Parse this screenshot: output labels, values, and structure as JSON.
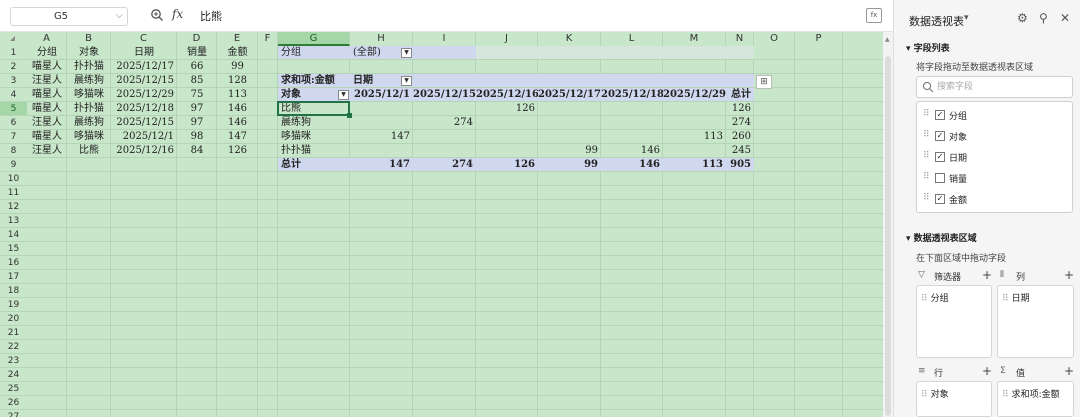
{
  "formula_bar": {
    "name_box": "G5",
    "fx_label": "fx",
    "content": "比熊"
  },
  "columns": [
    "A",
    "B",
    "C",
    "D",
    "E",
    "F",
    "G",
    "H",
    "I",
    "J",
    "K",
    "L",
    "M",
    "N",
    "O",
    "P"
  ],
  "selected_column": "G",
  "rows": [
    "1",
    "2",
    "3",
    "4",
    "5",
    "6",
    "7",
    "8",
    "9",
    "10",
    "11",
    "12",
    "13",
    "14",
    "15",
    "16",
    "17",
    "18",
    "19",
    "20",
    "21",
    "22",
    "23",
    "24",
    "25",
    "26",
    "27"
  ],
  "selected_row": "5",
  "source_table": {
    "headers": [
      "分组",
      "对象",
      "日期",
      "销量",
      "金额"
    ],
    "rows": [
      [
        "喵星人",
        "扑扑猫",
        "2025/12/17",
        "66",
        "99"
      ],
      [
        "汪星人",
        "晨练狗",
        "2025/12/15",
        "85",
        "128"
      ],
      [
        "喵星人",
        "哆猫咪",
        "2025/12/29",
        "75",
        "113"
      ],
      [
        "喵星人",
        "扑扑猫",
        "2025/12/18",
        "97",
        "146"
      ],
      [
        "汪星人",
        "晨练狗",
        "2025/12/15",
        "97",
        "146"
      ],
      [
        "喵星人",
        "哆猫咪",
        "2025/12/1",
        "98",
        "147"
      ],
      [
        "汪星人",
        "比熊",
        "2025/12/16",
        "84",
        "126"
      ]
    ]
  },
  "pivot": {
    "filter_label": "分组",
    "filter_value": "(全部)",
    "value_label": "求和项:金额",
    "col_field": "日期",
    "row_field": "对象",
    "col_headers": [
      "2025/12/1",
      "2025/12/15",
      "2025/12/16",
      "2025/12/17",
      "2025/12/18",
      "2025/12/29",
      "总计"
    ],
    "rows": [
      {
        "label": "比熊",
        "values": [
          "",
          "",
          "126",
          "",
          "",
          "",
          "126"
        ]
      },
      {
        "label": "晨练狗",
        "values": [
          "",
          "274",
          "",
          "",
          "",
          "",
          "274"
        ]
      },
      {
        "label": "哆猫咪",
        "values": [
          "147",
          "",
          "",
          "",
          "",
          "113",
          "260"
        ]
      },
      {
        "label": "扑扑猫",
        "values": [
          "",
          "",
          "",
          "99",
          "146",
          "",
          "245"
        ]
      }
    ],
    "total": {
      "label": "总计",
      "values": [
        "147",
        "274",
        "126",
        "99",
        "146",
        "113",
        "905"
      ]
    }
  },
  "panel": {
    "title": "数据透视表",
    "field_list_title": "字段列表",
    "field_list_hint": "将字段拖动至数据透视表区域",
    "search_placeholder": "搜索字段",
    "fields": [
      {
        "label": "分组",
        "checked": true
      },
      {
        "label": "对象",
        "checked": true
      },
      {
        "label": "日期",
        "checked": true
      },
      {
        "label": "销量",
        "checked": false
      },
      {
        "label": "金额",
        "checked": true
      }
    ],
    "areas_title": "数据透视表区域",
    "areas_hint": "在下面区域中拖动字段",
    "filter_area": {
      "label": "筛选器",
      "item": "分组"
    },
    "column_area": {
      "label": "列",
      "item": "日期"
    },
    "row_area": {
      "label": "行",
      "item": "对象"
    },
    "value_area": {
      "label": "值",
      "item": "求和项:金额"
    }
  },
  "colors": {
    "grid_bg": "#c8e6c9",
    "pivot_band": "#cfd8ee",
    "selection": "#217346"
  }
}
